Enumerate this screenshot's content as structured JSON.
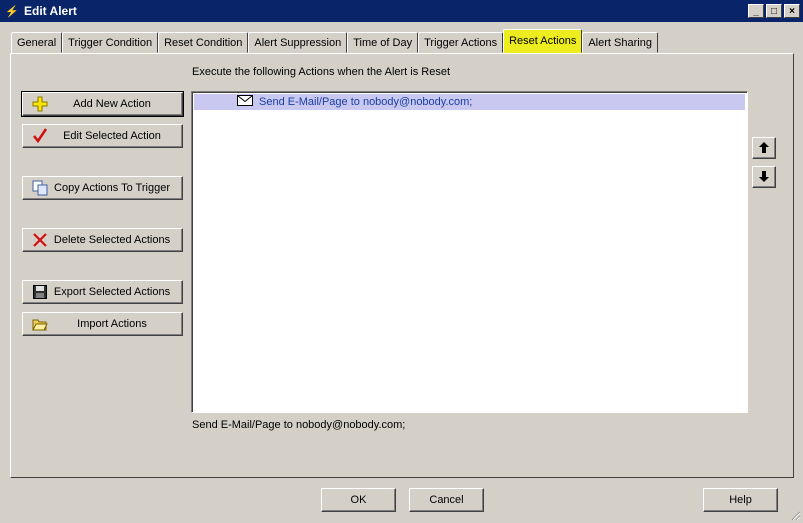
{
  "window": {
    "title": "Edit Alert",
    "controls": [
      "_",
      "□",
      "×"
    ]
  },
  "tabs": [
    {
      "label": "General",
      "active": false
    },
    {
      "label": "Trigger Condition",
      "active": false
    },
    {
      "label": "Reset Condition",
      "active": false
    },
    {
      "label": "Alert Suppression",
      "active": false
    },
    {
      "label": "Time of Day",
      "active": false
    },
    {
      "label": "Trigger Actions",
      "active": false
    },
    {
      "label": "Reset Actions",
      "active": true
    },
    {
      "label": "Alert Sharing",
      "active": false
    }
  ],
  "highlight_color": "#ecec1e",
  "main": {
    "caption": "Execute the following Actions when the Alert is Reset",
    "buttons": {
      "add": "Add New Action",
      "edit": "Edit Selected Action",
      "copy": "Copy Actions To Trigger",
      "delete": "Delete Selected Actions",
      "export": "Export Selected Actions",
      "import": "Import Actions"
    },
    "actions_list": [
      {
        "icon": "envelope-icon",
        "label": "Send E-Mail/Page to nobody@nobody.com;",
        "selected": true
      }
    ],
    "status_text": "Send E-Mail/Page to nobody@nobody.com;"
  },
  "footer": {
    "ok": "OK",
    "cancel": "Cancel",
    "help": "Help"
  }
}
